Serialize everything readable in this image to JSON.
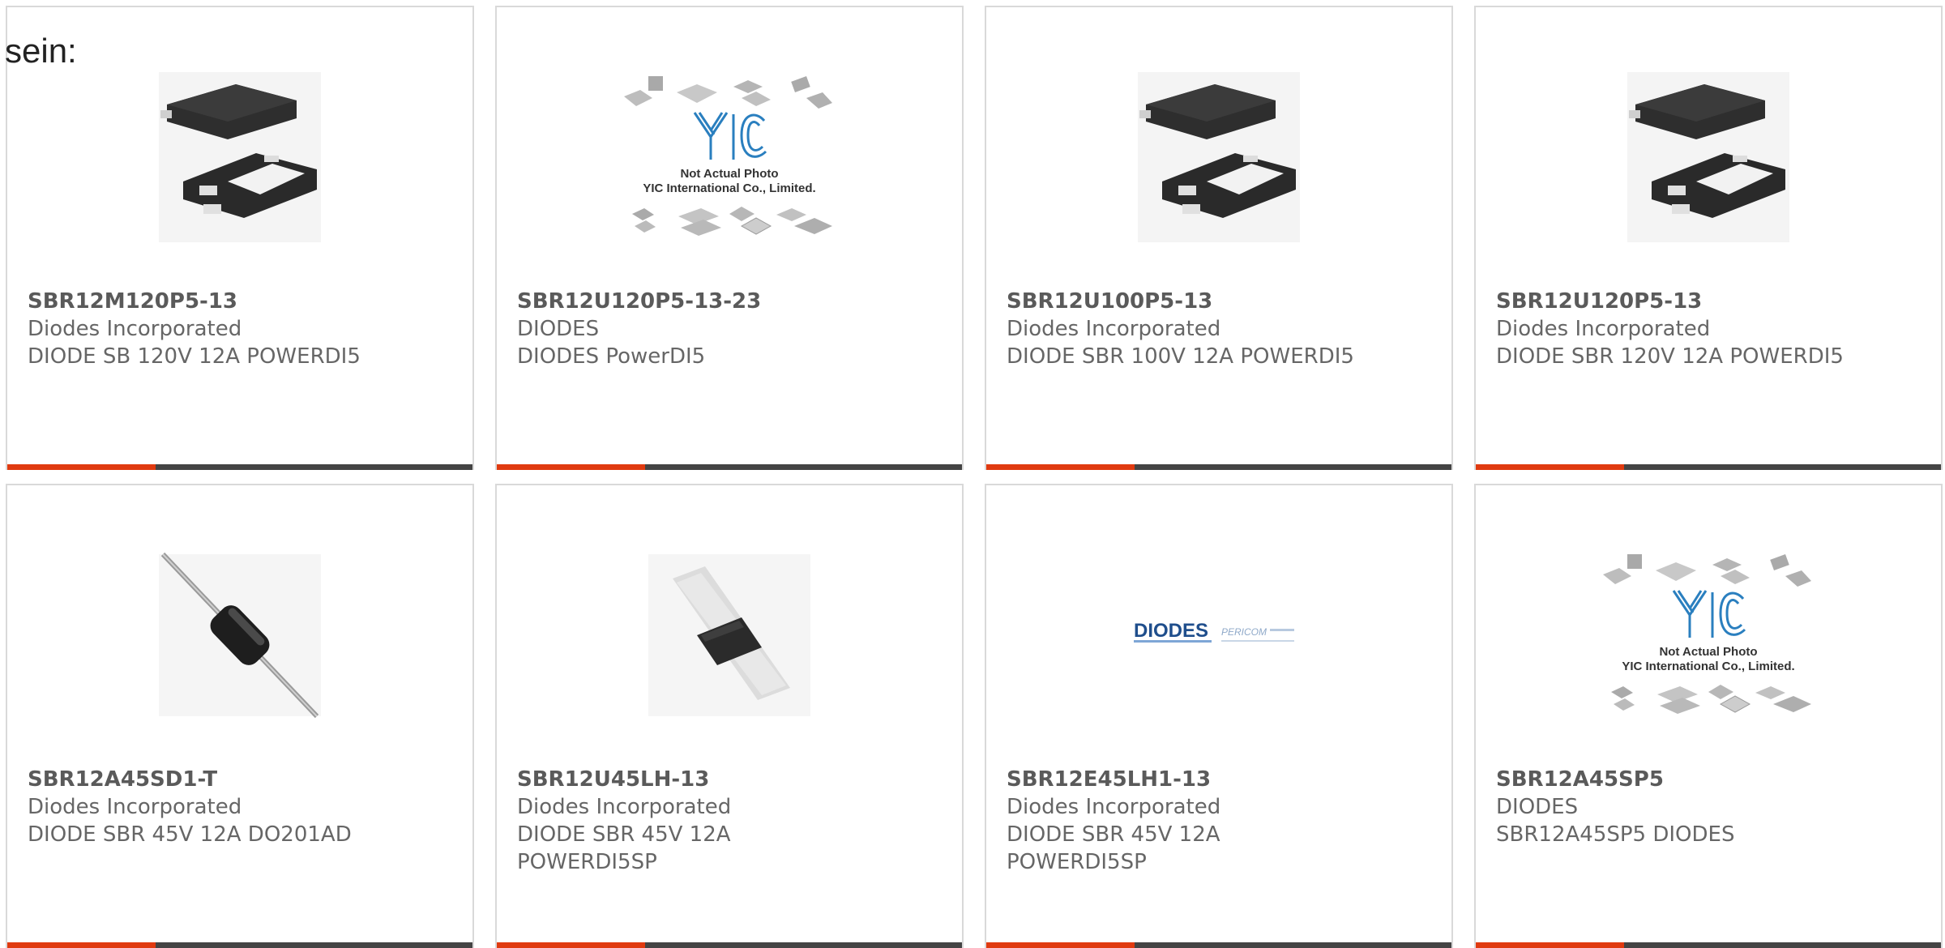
{
  "stray_text": "sein:",
  "colors": {
    "accent": "#e03a10",
    "bar": "#444444",
    "text": "#666666",
    "border": "#d9d9d9"
  },
  "products": [
    {
      "part_no": "SBR12M120P5-13",
      "manufacturer": "Diodes Incorporated",
      "description": "DIODE SB 120V 12A POWERDI5",
      "image": "powerdi5-package-icon"
    },
    {
      "part_no": "SBR12U120P5-13-23",
      "manufacturer": "DIODES",
      "description": "DIODES PowerDI5",
      "image": "yic-not-actual-photo",
      "image_caption_1": "Not Actual Photo",
      "image_caption_2": "YIC International Co., Limited."
    },
    {
      "part_no": "SBR12U100P5-13",
      "manufacturer": "Diodes Incorporated",
      "description": "DIODE SBR 100V 12A POWERDI5",
      "image": "powerdi5-package-icon"
    },
    {
      "part_no": "SBR12U120P5-13",
      "manufacturer": "Diodes Incorporated",
      "description": "DIODE SBR 120V 12A POWERDI5",
      "image": "powerdi5-package-icon"
    },
    {
      "part_no": "SBR12A45SD1-T",
      "manufacturer": "Diodes Incorporated",
      "description": "DIODE SBR 45V 12A DO201AD",
      "image": "axial-diode-icon"
    },
    {
      "part_no": "SBR12U45LH-13",
      "manufacturer": "Diodes Incorporated",
      "description_1": "DIODE SBR 45V 12A",
      "description_2": "POWERDI5SP",
      "image": "tape-package-icon"
    },
    {
      "part_no": "SBR12E45LH1-13",
      "manufacturer": "Diodes Incorporated",
      "description_1": "DIODE SBR 45V 12A",
      "description_2": "POWERDI5SP",
      "image": "diodes-pericom-logo",
      "logo_1": "DIODES",
      "logo_2": "PERICOM"
    },
    {
      "part_no": "SBR12A45SP5",
      "manufacturer": "DIODES",
      "description": "SBR12A45SP5 DIODES",
      "image": "yic-not-actual-photo",
      "image_caption_1": "Not Actual Photo",
      "image_caption_2": "YIC International Co., Limited."
    }
  ]
}
